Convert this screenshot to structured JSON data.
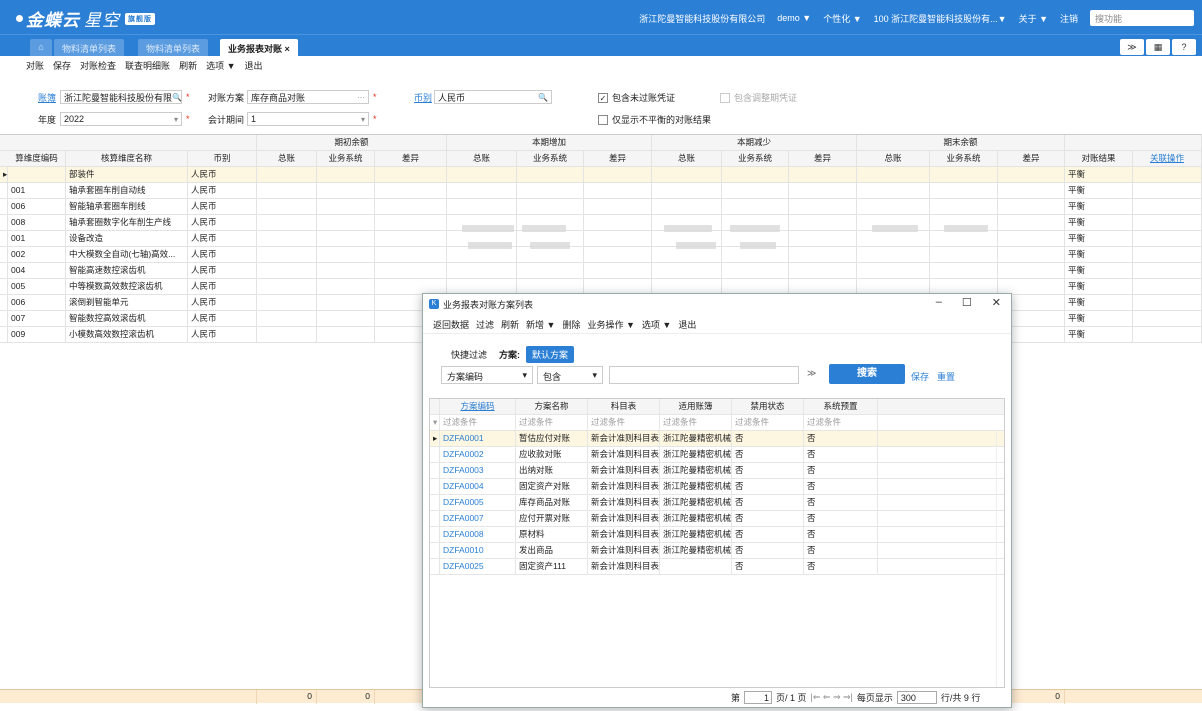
{
  "header": {
    "brand": "金蝶云",
    "brand_sub": "星空",
    "brand_badge": "旗舰版",
    "company": "浙江陀曼智能科技股份有限公司",
    "user": "demo ▼",
    "personalize": "个性化 ▼",
    "org": "100 浙江陀曼智能科技股份有...▼",
    "about": "关于 ▼",
    "logout": "注销",
    "search_placeholder": "搜功能"
  },
  "tabs": [
    {
      "label": "物料清单列表"
    },
    {
      "label": "物料清单列表"
    },
    {
      "label": "业务报表对账 ×"
    }
  ],
  "tab_icons": {
    "home": "home-icon",
    "expand": "≫",
    "grid": "▦",
    "help": "?"
  },
  "toolbar": [
    "对账",
    "保存",
    "对账检查",
    "联查明细账",
    "刷新",
    "选项 ▼",
    "退出"
  ],
  "filters": {
    "book_label": "账簿",
    "book_value": "浙江陀曼智能科技股份有限",
    "scheme_label": "对账方案",
    "scheme_value": "库存商品对账",
    "currency_label": "币别",
    "currency_value": "人民币",
    "year_label": "年度",
    "year_value": "2022",
    "period_label": "会计期间",
    "period_value": "1",
    "include_unposted": "包含未过账凭证",
    "include_adjust": "包含调整期凭证",
    "only_unbalanced": "仅显示不平衡的对账结果"
  },
  "main_table": {
    "groups": [
      "期初余额",
      "本期增加",
      "本期减少",
      "期末余额"
    ],
    "columns": [
      "算维度编码",
      "核算维度名称",
      "币别",
      "总账",
      "业务系统",
      "差异",
      "总账",
      "业务系统",
      "差异",
      "总账",
      "业务系统",
      "差异",
      "总账",
      "业务系统",
      "差异",
      "对账结果",
      "关联操作"
    ],
    "rows": [
      {
        "code": "",
        "name": "部装件",
        "currency": "人民币",
        "result": "平衡"
      },
      {
        "code": "001",
        "name": "轴承套圈车削自动线",
        "currency": "人民币",
        "result": "平衡"
      },
      {
        "code": "006",
        "name": "智能轴承套圈车削线",
        "currency": "人民币",
        "result": "平衡"
      },
      {
        "code": "008",
        "name": "轴承套圈数字化车削生产线",
        "currency": "人民币",
        "result": "平衡"
      },
      {
        "code": "001",
        "name": "设备改造",
        "currency": "人民币",
        "result": "平衡"
      },
      {
        "code": "002",
        "name": "中大模数全自动(七轴)高效...",
        "currency": "人民币",
        "result": "平衡"
      },
      {
        "code": "004",
        "name": "智能高速数控滚齿机",
        "currency": "人民币",
        "result": "平衡"
      },
      {
        "code": "005",
        "name": "中等模数高效数控滚齿机",
        "currency": "人民币",
        "result": "平衡"
      },
      {
        "code": "006",
        "name": "滚倒剃智能单元",
        "currency": "人民币",
        "result": "平衡"
      },
      {
        "code": "007",
        "name": "智能数控高效滚齿机",
        "currency": "人民币",
        "result": "平衡"
      },
      {
        "code": "009",
        "name": "小模数高效数控滚齿机",
        "currency": "人民币",
        "result": "平衡"
      }
    ],
    "footer": {
      "v1": "0",
      "v2": "0",
      "v3": "0"
    }
  },
  "modal": {
    "title": "业务报表对账方案列表",
    "toolbar": [
      "返回数据",
      "过滤",
      "刷新",
      "新增 ▼",
      "删除",
      "业务操作 ▼",
      "选项 ▼",
      "退出"
    ],
    "quick_filter": "快捷过滤",
    "scheme_label": "方案:",
    "scheme_default": "默认方案",
    "search_field": "方案编码",
    "search_op": "包含",
    "search_button": "搜索",
    "save_link": "保存",
    "reset_link": "重置",
    "columns": [
      "方案编码",
      "方案名称",
      "科目表",
      "适用账簿",
      "禁用状态",
      "系统预置"
    ],
    "filter_hint": "过滤条件",
    "rows": [
      {
        "code": "DZFA0001",
        "name": "暂估应付对账",
        "chart": "新会计准则科目表",
        "book": "浙江陀曼精密机械",
        "disabled": "否",
        "preset": "否"
      },
      {
        "code": "DZFA0002",
        "name": "应收款对账",
        "chart": "新会计准则科目表",
        "book": "浙江陀曼精密机械",
        "disabled": "否",
        "preset": "否"
      },
      {
        "code": "DZFA0003",
        "name": "出纳对账",
        "chart": "新会计准则科目表",
        "book": "浙江陀曼精密机械",
        "disabled": "否",
        "preset": "否"
      },
      {
        "code": "DZFA0004",
        "name": "固定资产对账",
        "chart": "新会计准则科目表",
        "book": "浙江陀曼精密机械",
        "disabled": "否",
        "preset": "否"
      },
      {
        "code": "DZFA0005",
        "name": "库存商品对账",
        "chart": "新会计准则科目表",
        "book": "浙江陀曼精密机械",
        "disabled": "否",
        "preset": "否"
      },
      {
        "code": "DZFA0007",
        "name": "应付开票对账",
        "chart": "新会计准则科目表",
        "book": "浙江陀曼精密机械",
        "disabled": "否",
        "preset": "否"
      },
      {
        "code": "DZFA0008",
        "name": "原材料",
        "chart": "新会计准则科目表",
        "book": "浙江陀曼精密机械",
        "disabled": "否",
        "preset": "否"
      },
      {
        "code": "DZFA0010",
        "name": "发出商品",
        "chart": "新会计准则科目表",
        "book": "浙江陀曼精密机械",
        "disabled": "否",
        "preset": "否"
      },
      {
        "code": "DZFA0025",
        "name": "固定资产111",
        "chart": "新会计准则科目表",
        "book": "",
        "disabled": "否",
        "preset": "否"
      }
    ],
    "pager": {
      "prefix": "第",
      "page": "1",
      "suffix": "页/ 1 页",
      "nav": "|⇐ ⇐ ⇒ ⇒|",
      "per_page_label": "每页显示",
      "per_page": "300",
      "total": "行/共 9 行"
    }
  },
  "colors": {
    "brand": "#2b7fd4",
    "selected_row": "#fdf6e0",
    "footer": "#fdebd2"
  }
}
